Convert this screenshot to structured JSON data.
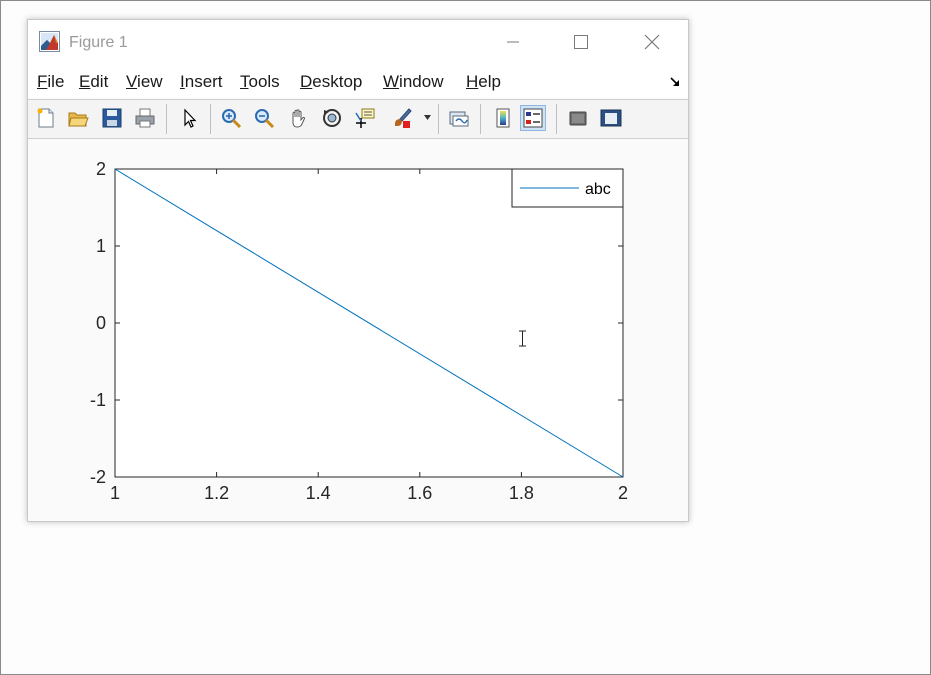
{
  "window": {
    "title": "Figure 1",
    "app_icon": "matlab-icon"
  },
  "controls": {
    "minimize": "minimize-icon",
    "maximize": "maximize-icon",
    "close": "close-icon"
  },
  "menu": {
    "items": [
      {
        "label": "File",
        "accel": "F",
        "rest": "ile"
      },
      {
        "label": "Edit",
        "accel": "E",
        "rest": "dit"
      },
      {
        "label": "View",
        "accel": "V",
        "rest": "iew"
      },
      {
        "label": "Insert",
        "accel": "I",
        "rest": "nsert"
      },
      {
        "label": "Tools",
        "accel": "T",
        "rest": "ools"
      },
      {
        "label": "Desktop",
        "accel": "D",
        "rest": "esktop"
      },
      {
        "label": "Window",
        "accel": "W",
        "rest": "indow"
      },
      {
        "label": "Help",
        "accel": "H",
        "rest": "elp"
      }
    ]
  },
  "toolbar": {
    "buttons": [
      "new-figure-icon",
      "open-file-icon",
      "save-icon",
      "print-icon",
      "edit-plot-arrow-icon",
      "zoom-in-icon",
      "zoom-out-icon",
      "pan-hand-icon",
      "rotate-3d-icon",
      "data-cursor-icon",
      "brush-icon",
      "link-plot-icon",
      "colorbar-icon",
      "legend-icon",
      "hide-plot-tools-icon",
      "show-plot-tools-icon"
    ],
    "active": "legend-icon"
  },
  "colors": {
    "line": "#0072bd",
    "title_gray": "#9a9a9a"
  },
  "chart_data": {
    "type": "line",
    "series": [
      {
        "name": "abc",
        "x": [
          1,
          2
        ],
        "y": [
          2,
          -2
        ]
      }
    ],
    "xlim": [
      1,
      2
    ],
    "ylim": [
      -2,
      2
    ],
    "xticks": [
      1,
      1.2,
      1.4,
      1.6,
      1.8,
      2
    ],
    "xtick_labels": [
      "1",
      "1.2",
      "1.4",
      "1.6",
      "1.8",
      "2"
    ],
    "yticks": [
      -2,
      -1,
      0,
      1,
      2
    ],
    "ytick_labels": [
      "-2",
      "-1",
      "0",
      "1",
      "2"
    ],
    "grid": false,
    "legend": "top-right",
    "title": "",
    "xlabel": "",
    "ylabel": ""
  }
}
